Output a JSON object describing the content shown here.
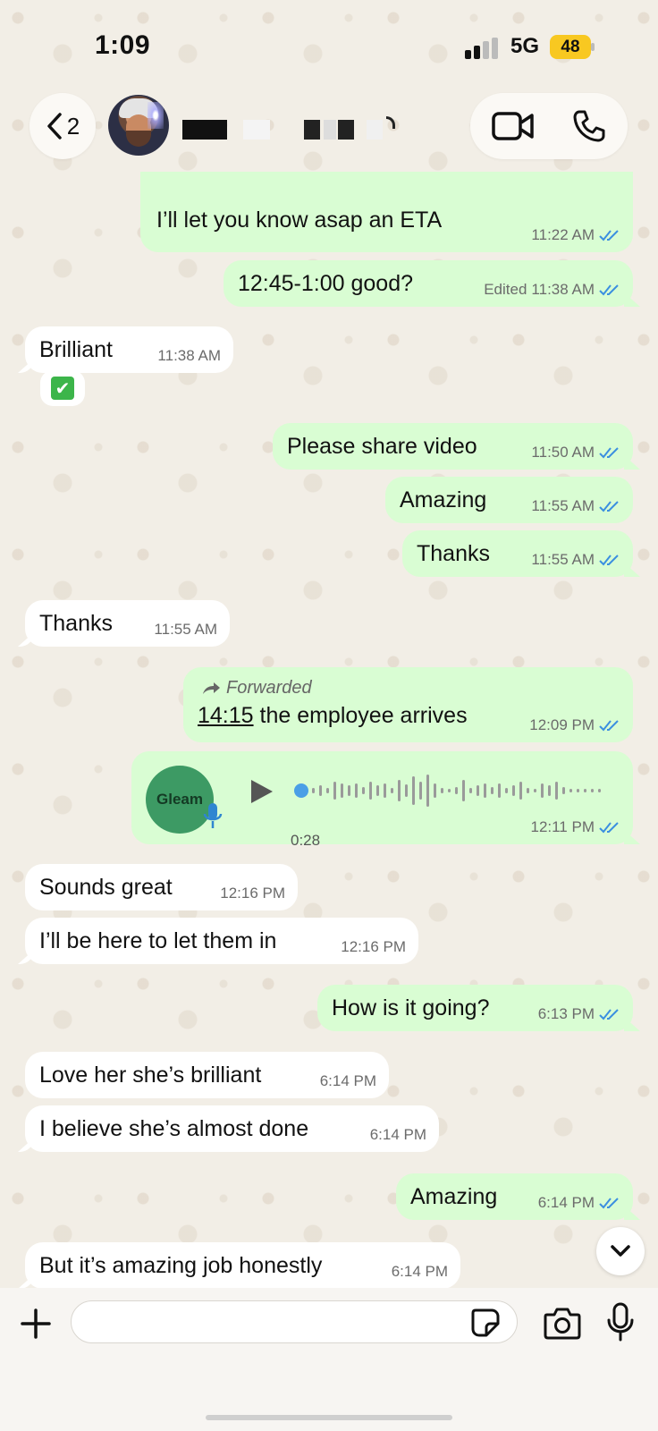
{
  "status_bar": {
    "time": "1:09",
    "network": "5G",
    "battery": "48"
  },
  "header": {
    "back_count": "2"
  },
  "messages": {
    "m1": {
      "text": "I’ll let you know asap an ETA",
      "time": "11:22 AM"
    },
    "m2": {
      "text": "12:45-1:00 good?",
      "edited": "Edited",
      "time": "11:38 AM"
    },
    "m3": {
      "text": "Brilliant",
      "time": "11:38 AM",
      "reaction": "✔"
    },
    "m4": {
      "text": "Please share video",
      "time": "11:50 AM"
    },
    "m5": {
      "text": "Amazing",
      "time": "11:55 AM"
    },
    "m6": {
      "text": "Thanks",
      "time": "11:55 AM"
    },
    "m7": {
      "text": "Thanks",
      "time": "11:55 AM"
    },
    "m8": {
      "forwarded": "Forwarded",
      "link": "14:15",
      "text": " the employee arrives",
      "time": "12:09 PM"
    },
    "m9": {
      "avatar_label": "Gleam",
      "duration": "0:28",
      "time": "12:11 PM"
    },
    "m10": {
      "text": "Sounds great",
      "time": "12:16 PM"
    },
    "m11": {
      "text": "I’ll be here to let them in",
      "time": "12:16 PM"
    },
    "m12": {
      "text": "How is it going?",
      "time": "6:13 PM"
    },
    "m13": {
      "text": "Love her she’s brilliant",
      "time": "6:14 PM"
    },
    "m14": {
      "text": "I believe she’s almost done",
      "time": "6:14 PM"
    },
    "m15": {
      "text": "Amazing",
      "time": "6:14 PM"
    },
    "m16": {
      "text": "But it’s amazing job honestly",
      "time": "6:14 PM"
    }
  },
  "composer": {
    "placeholder": ""
  },
  "colors": {
    "outgoing": "#d9fdd3",
    "incoming": "#ffffff",
    "read_ticks": "#3b8fe0",
    "battery": "#f8c821"
  }
}
